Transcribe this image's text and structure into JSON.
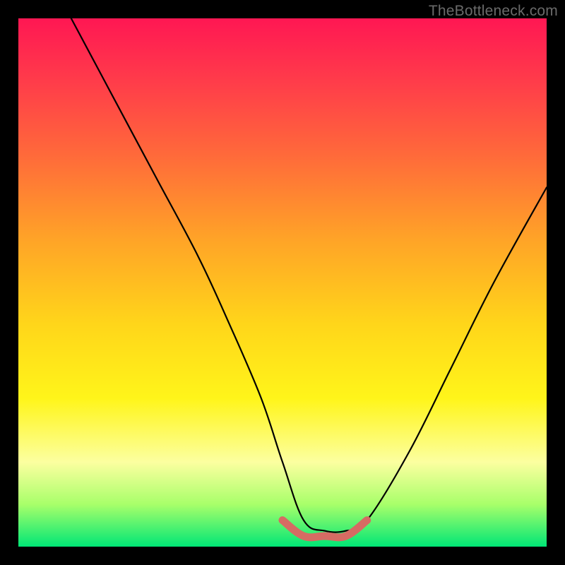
{
  "watermark": "TheBottleneck.com",
  "chart_data": {
    "type": "line",
    "title": "",
    "xlabel": "",
    "ylabel": "",
    "xlim": [
      0,
      100
    ],
    "ylim": [
      0,
      100
    ],
    "grid": false,
    "legend": false,
    "annotations": [],
    "series": [
      {
        "name": "black-curve",
        "type": "line",
        "color": "#000000",
        "x": [
          10,
          18,
          26,
          34,
          40,
          46,
          50,
          54,
          58,
          62,
          66,
          74,
          82,
          90,
          100
        ],
        "y": [
          100,
          85,
          70,
          55,
          42,
          28,
          16,
          5,
          3,
          3,
          5,
          18,
          34,
          50,
          68
        ]
      },
      {
        "name": "red-floor-segment",
        "type": "line",
        "color": "#d66b63",
        "x": [
          50,
          54,
          58,
          62,
          66
        ],
        "y": [
          5,
          2,
          2,
          2,
          5
        ]
      }
    ],
    "background": {
      "type": "vertical-gradient",
      "stops": [
        {
          "pos": 0,
          "color": "#ff1753"
        },
        {
          "pos": 12,
          "color": "#ff3c4a"
        },
        {
          "pos": 26,
          "color": "#ff6a3a"
        },
        {
          "pos": 42,
          "color": "#ffa427"
        },
        {
          "pos": 58,
          "color": "#ffd61a"
        },
        {
          "pos": 72,
          "color": "#fff51a"
        },
        {
          "pos": 84,
          "color": "#fcffa0"
        },
        {
          "pos": 92,
          "color": "#a8ff6a"
        },
        {
          "pos": 100,
          "color": "#00e676"
        }
      ]
    }
  }
}
